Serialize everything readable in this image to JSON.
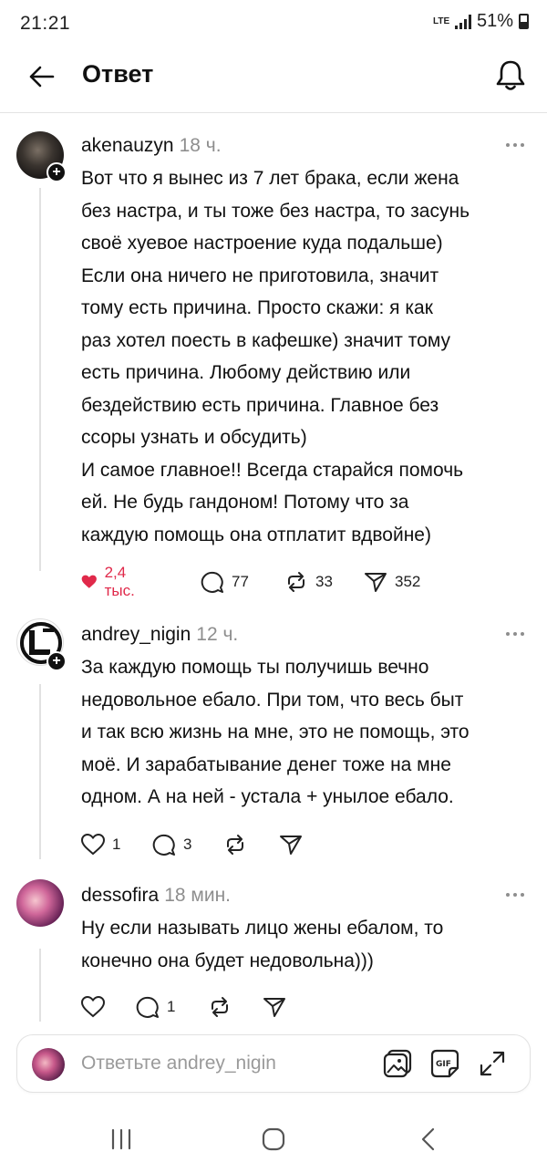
{
  "status_bar": {
    "time": "21:21",
    "network": "LTE",
    "battery": "51%"
  },
  "header": {
    "title": "Ответ"
  },
  "posts": [
    {
      "username": "akenauzyn",
      "time": "18 ч.",
      "text": "Вот что я вынес из 7 лет брака, если жена без настра, и ты тоже без настра, то засунь своё хуевое настроение куда подальше)\nЕсли она ничего не приготовила, значит тому есть причина. Просто скажи: я как раз хотел поесть в кафешке) значит тому есть причина. Любому действию или бездействию есть причина. Главное без ссоры узнать и обсудить)\nИ самое главное!! Всегда старайся помочь ей. Не будь гандоном! Потому что за каждую помощь она отплатит вдвойне)",
      "likes": "2,4 тыс.",
      "replies": "77",
      "reposts": "33",
      "shares": "352",
      "liked": true
    },
    {
      "username": "andrey_nigin",
      "time": "12 ч.",
      "text": "За каждую помощь ты получишь вечно недовольное ебало. При том, что весь быт и так всю жизнь на мне, это не помощь, это моё. И зарабатывание денег тоже на мне одном. А на ней - устала + унылое ебало.",
      "likes": "1",
      "replies": "3",
      "reposts": "",
      "shares": "",
      "liked": false
    },
    {
      "username": "dessofira",
      "time": "18 мин.",
      "text": "Ну если называть лицо жены ебалом, то конечно она будет недовольна)))",
      "likes": "",
      "replies": "1",
      "reposts": "",
      "shares": "",
      "liked": false
    }
  ],
  "reply_bar": {
    "placeholder": "Ответьте andrey_nigin",
    "gif_label": "GIF"
  },
  "colors": {
    "like_red": "#e0294a",
    "text": "#111111",
    "muted": "#8e8e8e",
    "divider": "#e3e3e3"
  },
  "icons": [
    "back-arrow-icon",
    "bell-icon",
    "more-icon",
    "heart-icon",
    "comment-icon",
    "repost-icon",
    "share-icon",
    "image-icon",
    "gif-icon",
    "expand-icon",
    "recent-apps-icon",
    "home-icon",
    "back-nav-icon"
  ]
}
